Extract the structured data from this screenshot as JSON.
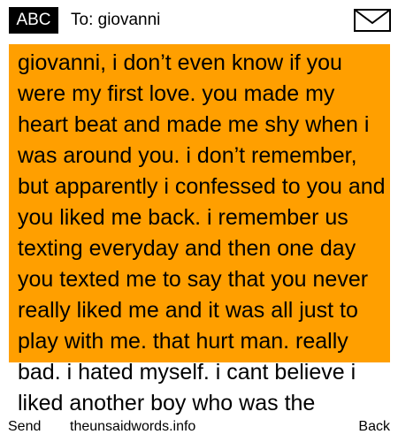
{
  "header": {
    "mode_label": "ABC",
    "to_label": "To: giovanni",
    "icon": "envelope-icon"
  },
  "message": {
    "body": "giovanni, i don’t even know if you were my first love. you made my heart beat and made me shy when i was around you. i don’t remember, but apparently i confessed to you and you liked me back. i remember us texting everyday and then one day you texted me to say that you never really liked me and it was all just to play with me. that hurt man. really bad. i hated myself. i cant believe i liked another boy who was the"
  },
  "footer": {
    "send_label": "Send",
    "site_label": "theunsaidwords.info",
    "back_label": "Back"
  },
  "colors": {
    "accent": "#ff9f00",
    "badge_bg": "#000000",
    "badge_text": "#ffffff"
  }
}
